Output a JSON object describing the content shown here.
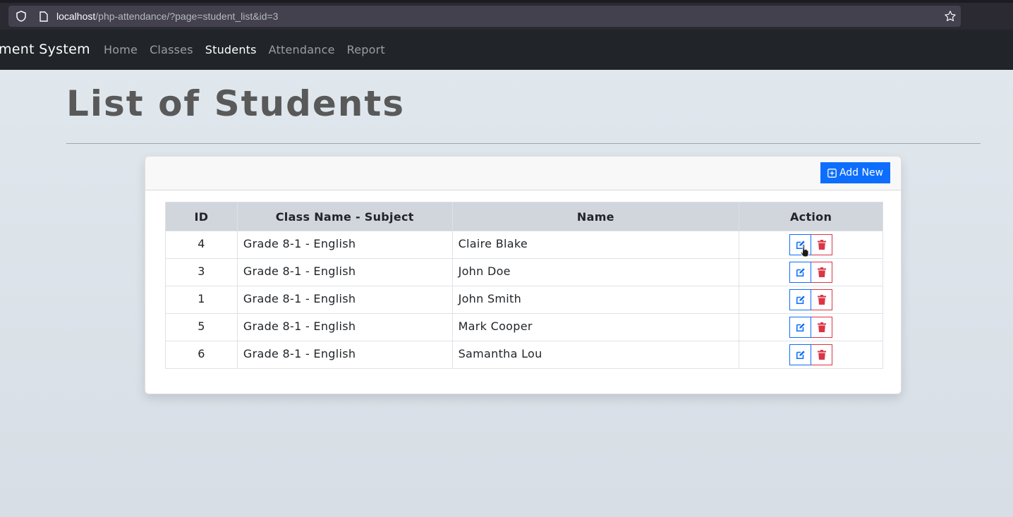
{
  "browser": {
    "url_host": "localhost",
    "url_path": "/php-attendance/?page=student_list&id=3"
  },
  "navbar": {
    "brand": "ment System",
    "links": [
      {
        "label": "Home",
        "active": false
      },
      {
        "label": "Classes",
        "active": false
      },
      {
        "label": "Students",
        "active": true
      },
      {
        "label": "Attendance",
        "active": false
      },
      {
        "label": "Report",
        "active": false
      }
    ]
  },
  "page": {
    "title": "List of Students"
  },
  "card": {
    "add_button_label": "Add New"
  },
  "table": {
    "headers": [
      "ID",
      "Class Name - Subject",
      "Name",
      "Action"
    ],
    "rows": [
      {
        "id": "4",
        "class_subject": "Grade 8-1 - English",
        "name": "Claire Blake"
      },
      {
        "id": "3",
        "class_subject": "Grade 8-1 - English",
        "name": "John Doe"
      },
      {
        "id": "1",
        "class_subject": "Grade 8-1 - English",
        "name": "John Smith"
      },
      {
        "id": "5",
        "class_subject": "Grade 8-1 - English",
        "name": "Mark Cooper"
      },
      {
        "id": "6",
        "class_subject": "Grade 8-1 - English",
        "name": "Samantha Lou"
      }
    ]
  },
  "colors": {
    "navbar_bg": "#212529",
    "primary": "#0d6efd",
    "danger": "#dc3545",
    "title": "#595959"
  },
  "icons": {
    "edit": "pencil-square-icon",
    "delete": "trash-icon",
    "add": "plus-square-icon"
  }
}
